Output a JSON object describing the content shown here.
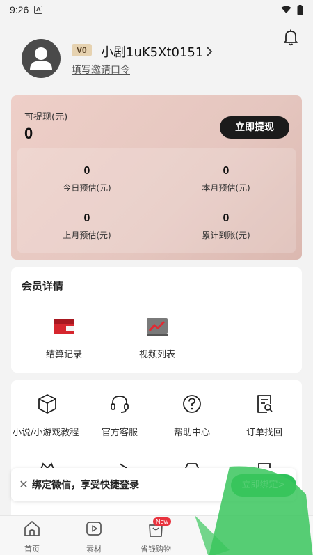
{
  "status_bar": {
    "time": "9:26",
    "notification_icon": "A"
  },
  "profile": {
    "level": "V0",
    "username": "小剧1uK5Xt0151",
    "invite_link": "填写邀请口令"
  },
  "earnings": {
    "withdrawable_label": "可提现(元)",
    "withdrawable_value": "0",
    "withdraw_button": "立即提现",
    "stats": [
      {
        "value": "0",
        "label": "今日预估(元)"
      },
      {
        "value": "0",
        "label": "本月预估(元)"
      },
      {
        "value": "0",
        "label": "上月预估(元)"
      },
      {
        "value": "0",
        "label": "累计到账(元)"
      }
    ]
  },
  "member": {
    "title": "会员详情",
    "items": [
      {
        "label": "结算记录",
        "icon": "settlement-icon"
      },
      {
        "label": "视频列表",
        "icon": "video-list-icon"
      }
    ]
  },
  "tools": [
    {
      "label": "小说/小游戏教程",
      "icon": "cube-icon"
    },
    {
      "label": "官方客服",
      "icon": "headset-icon"
    },
    {
      "label": "帮助中心",
      "icon": "help-icon"
    },
    {
      "label": "订单找回",
      "icon": "order-search-icon"
    }
  ],
  "bind_banner": {
    "text": "绑定微信，享受快捷登录",
    "button": "立即绑定>"
  },
  "tabbar": {
    "items": [
      {
        "label": "首页",
        "icon": "home-icon"
      },
      {
        "label": "素材",
        "icon": "play-icon"
      },
      {
        "label": "省钱购物",
        "icon": "shopping-bag-icon"
      }
    ],
    "badge": "New"
  },
  "colors": {
    "withdraw_button": "#1b1b1b",
    "bind_button": "#2fc25b",
    "badge": "#e8333e",
    "card_gradient": "#e5c6bf"
  }
}
